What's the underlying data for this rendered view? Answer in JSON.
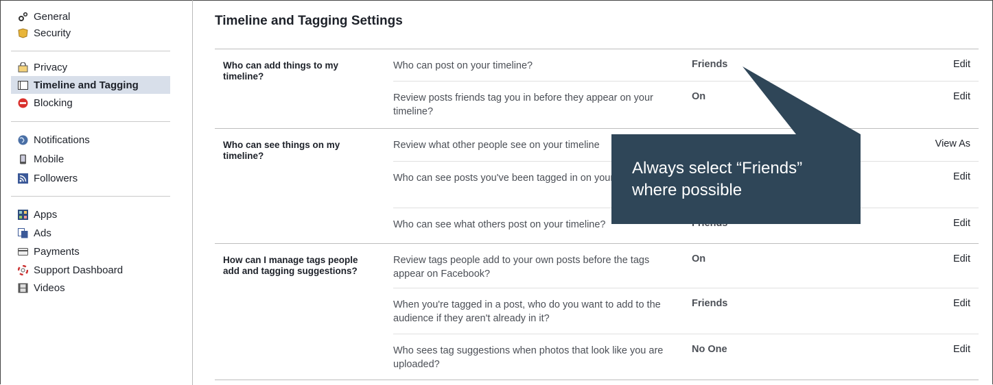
{
  "sidebar": {
    "groups": [
      [
        {
          "label": "General",
          "icon": "gears-icon"
        },
        {
          "label": "Security",
          "icon": "badge-icon"
        }
      ],
      [
        {
          "label": "Privacy",
          "icon": "lock-icon"
        },
        {
          "label": "Timeline and Tagging",
          "icon": "timeline-icon",
          "active": true
        },
        {
          "label": "Blocking",
          "icon": "block-icon"
        }
      ],
      [
        {
          "label": "Notifications",
          "icon": "globe-icon"
        },
        {
          "label": "Mobile",
          "icon": "mobile-icon"
        },
        {
          "label": "Followers",
          "icon": "rss-icon"
        }
      ],
      [
        {
          "label": "Apps",
          "icon": "apps-icon"
        },
        {
          "label": "Ads",
          "icon": "ads-icon"
        },
        {
          "label": "Payments",
          "icon": "card-icon"
        },
        {
          "label": "Support Dashboard",
          "icon": "lifebuoy-icon"
        },
        {
          "label": "Videos",
          "icon": "film-icon"
        }
      ]
    ]
  },
  "main": {
    "title": "Timeline and Tagging Settings",
    "sections": [
      {
        "label": "Who can add things to my timeline?",
        "rows": [
          {
            "question": "Who can post on your timeline?",
            "value": "Friends",
            "action": "Edit"
          },
          {
            "question": "Review posts friends tag you in before they appear on your timeline?",
            "value": "On",
            "action": "Edit"
          }
        ]
      },
      {
        "label": "Who can see things on my timeline?",
        "rows": [
          {
            "question": "Review what other people see on your timeline",
            "value": "",
            "action": "View As"
          },
          {
            "question": "Who can see posts you've been tagged in on your timeline?",
            "value": "",
            "action": "Edit"
          },
          {
            "question": "Who can see what others post on your timeline?",
            "value": "Friends",
            "action": "Edit"
          }
        ]
      },
      {
        "label": "How can I manage tags people add and tagging suggestions?",
        "rows": [
          {
            "question": "Review tags people add to your own posts before the tags appear on Facebook?",
            "value": "On",
            "action": "Edit"
          },
          {
            "question": "When you're tagged in a post, who do you want to add to the audience if they aren't already in it?",
            "value": "Friends",
            "action": "Edit"
          },
          {
            "question": "Who sees tag suggestions when photos that look like you are uploaded?",
            "value": "No One",
            "action": "Edit"
          }
        ]
      }
    ]
  },
  "callout": {
    "text": "Always select “Friends” where possible",
    "color": "#2f4658"
  }
}
